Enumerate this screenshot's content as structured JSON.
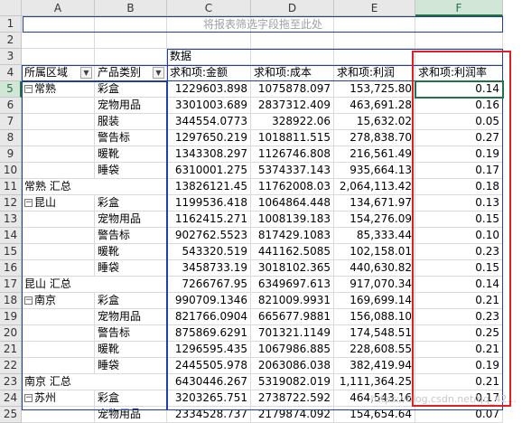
{
  "columns": [
    "A",
    "B",
    "C",
    "D",
    "E",
    "F"
  ],
  "rows": [
    "1",
    "2",
    "3",
    "4",
    "5",
    "6",
    "7",
    "8",
    "9",
    "10",
    "11",
    "12",
    "13",
    "14",
    "15",
    "16",
    "17",
    "18",
    "19",
    "20",
    "21",
    "22",
    "23",
    "24",
    "25"
  ],
  "filter_placeholder": "将报表筛选字段拖至此处",
  "data_label": "数据",
  "headers": {
    "region": "所属区域",
    "category": "产品类别",
    "sales": "求和项:金额",
    "cost": "求和项:成本",
    "profit": "求和项:利润",
    "margin": "求和项:利润率"
  },
  "table": [
    {
      "region": "常熟",
      "collapse": "−",
      "cat": "彩盒",
      "c": "1229603.898",
      "d": "1075878.097",
      "e": "153,725.80",
      "f": "0.14"
    },
    {
      "region": "",
      "collapse": "",
      "cat": "宠物用品",
      "c": "3301003.689",
      "d": "2837312.409",
      "e": "463,691.28",
      "f": "0.16"
    },
    {
      "region": "",
      "collapse": "",
      "cat": "服装",
      "c": "344554.0773",
      "d": "328922.06",
      "e": "15,632.02",
      "f": "0.05"
    },
    {
      "region": "",
      "collapse": "",
      "cat": "警告标",
      "c": "1297650.219",
      "d": "1018811.515",
      "e": "278,838.70",
      "f": "0.27"
    },
    {
      "region": "",
      "collapse": "",
      "cat": "暖靴",
      "c": "1343308.297",
      "d": "1126746.808",
      "e": "216,561.49",
      "f": "0.19"
    },
    {
      "region": "",
      "collapse": "",
      "cat": "睡袋",
      "c": "6310001.275",
      "d": "5374337.143",
      "e": "935,664.13",
      "f": "0.17"
    },
    {
      "region": "常熟 汇总",
      "collapse": "",
      "cat": "",
      "c": "13826121.45",
      "d": "11762008.03",
      "e": "2,064,113.42",
      "f": "0.18"
    },
    {
      "region": "昆山",
      "collapse": "−",
      "cat": "彩盒",
      "c": "1199536.418",
      "d": "1064864.448",
      "e": "134,671.97",
      "f": "0.13"
    },
    {
      "region": "",
      "collapse": "",
      "cat": "宠物用品",
      "c": "1162415.271",
      "d": "1008139.183",
      "e": "154,276.09",
      "f": "0.15"
    },
    {
      "region": "",
      "collapse": "",
      "cat": "警告标",
      "c": "902762.5523",
      "d": "817429.1083",
      "e": "85,333.44",
      "f": "0.10"
    },
    {
      "region": "",
      "collapse": "",
      "cat": "暖靴",
      "c": "543320.519",
      "d": "441162.5085",
      "e": "102,158.01",
      "f": "0.23"
    },
    {
      "region": "",
      "collapse": "",
      "cat": "睡袋",
      "c": "3458733.19",
      "d": "3018102.365",
      "e": "440,630.82",
      "f": "0.15"
    },
    {
      "region": "昆山 汇总",
      "collapse": "",
      "cat": "",
      "c": "7266767.95",
      "d": "6349697.613",
      "e": "917,070.34",
      "f": "0.14"
    },
    {
      "region": "南京",
      "collapse": "−",
      "cat": "彩盒",
      "c": "990709.1346",
      "d": "821009.9931",
      "e": "169,699.14",
      "f": "0.21"
    },
    {
      "region": "",
      "collapse": "",
      "cat": "宠物用品",
      "c": "821766.0904",
      "d": "665677.9881",
      "e": "156,088.10",
      "f": "0.23"
    },
    {
      "region": "",
      "collapse": "",
      "cat": "警告标",
      "c": "875869.6291",
      "d": "701321.1149",
      "e": "174,548.51",
      "f": "0.25"
    },
    {
      "region": "",
      "collapse": "",
      "cat": "暖靴",
      "c": "1296595.435",
      "d": "1067986.885",
      "e": "228,608.55",
      "f": "0.21"
    },
    {
      "region": "",
      "collapse": "",
      "cat": "睡袋",
      "c": "2445505.978",
      "d": "2063086.038",
      "e": "382,419.94",
      "f": "0.19"
    },
    {
      "region": "南京 汇总",
      "collapse": "",
      "cat": "",
      "c": "6430446.267",
      "d": "5319082.019",
      "e": "1,111,364.25",
      "f": "0.21"
    },
    {
      "region": "苏州",
      "collapse": "−",
      "cat": "彩盒",
      "c": "3203265.751",
      "d": "2738722.592",
      "e": "464,543.16",
      "f": "0.17"
    },
    {
      "region": "",
      "collapse": "",
      "cat": "宠物用品",
      "c": "2334528.737",
      "d": "2179874.092",
      "e": "154,654.64",
      "f": "0.07"
    }
  ],
  "watermark": "https://blog.csdn.net/qq_42..."
}
